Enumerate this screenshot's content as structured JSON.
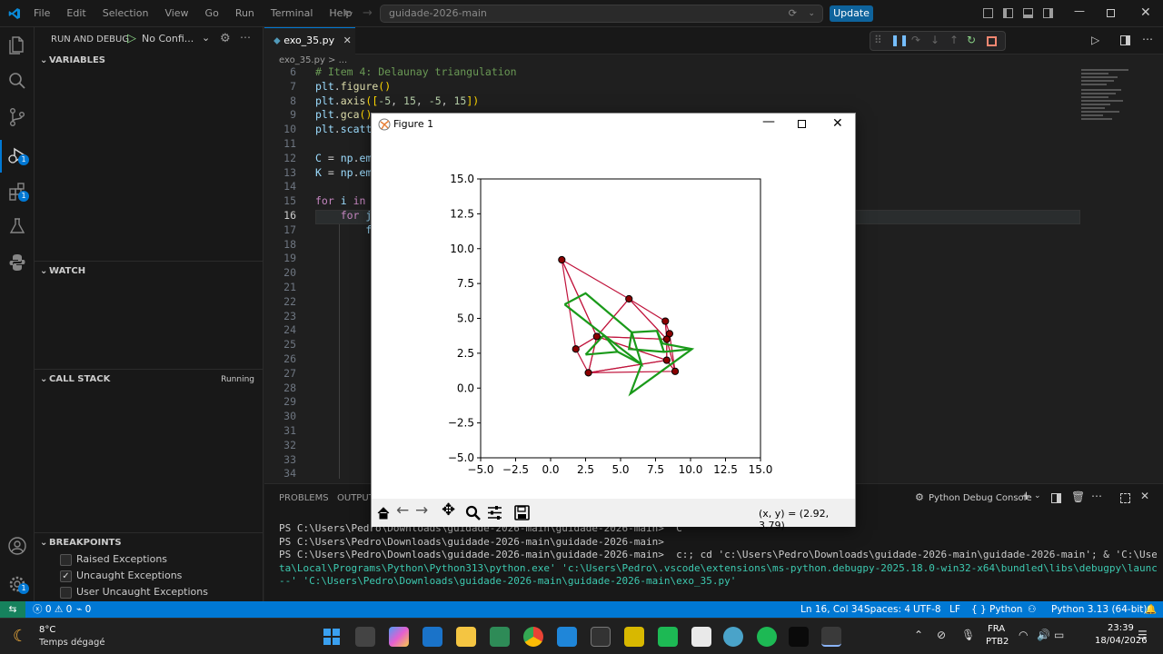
{
  "titlebar": {
    "menus": [
      "File",
      "Edit",
      "Selection",
      "View",
      "Go",
      "Run",
      "Terminal",
      "Help"
    ],
    "search_text": "guidade-2026-main",
    "update_label": "Update"
  },
  "activity": {
    "run_badge": "1",
    "ext_badge": "1"
  },
  "sidebar": {
    "run_title": "RUN AND DEBUG",
    "config": "No Confi...",
    "variables": "VARIABLES",
    "watch": "WATCH",
    "call_stack": "CALL STACK",
    "call_stack_status": "Running",
    "breakpoints": "BREAKPOINTS",
    "bp_items": [
      {
        "label": "Raised Exceptions",
        "checked": false
      },
      {
        "label": "Uncaught Exceptions",
        "checked": true
      },
      {
        "label": "User Uncaught Exceptions",
        "checked": false
      }
    ]
  },
  "editor": {
    "tab_label": "exo_35.py",
    "breadcrumb": "exo_35.py > ...",
    "lines": [
      {
        "n": "6",
        "text": "# Item 4: Delaunay triangulation"
      },
      {
        "n": "7",
        "text": "plt.figure()"
      },
      {
        "n": "8",
        "text": "plt.axis([-5, 15, -5, 15])"
      },
      {
        "n": "9",
        "text": "plt.gca()."
      },
      {
        "n": "10",
        "text": "plt.scatte"
      },
      {
        "n": "11",
        "text": ""
      },
      {
        "n": "12",
        "text": "C = np.emp"
      },
      {
        "n": "13",
        "text": "K = np.emp"
      },
      {
        "n": "14",
        "text": ""
      },
      {
        "n": "15",
        "text": "for i in r"
      },
      {
        "n": "16",
        "text": "    for j"
      },
      {
        "n": "17",
        "text": "        fo"
      },
      {
        "n": "18",
        "text": ""
      },
      {
        "n": "19",
        "text": ""
      },
      {
        "n": "20",
        "text": ""
      },
      {
        "n": "21",
        "text": ""
      },
      {
        "n": "22",
        "text": ""
      },
      {
        "n": "23",
        "text": ""
      },
      {
        "n": "24",
        "text": ""
      },
      {
        "n": "25",
        "text": ""
      },
      {
        "n": "26",
        "text": ""
      },
      {
        "n": "27",
        "text": ""
      },
      {
        "n": "28",
        "text": ""
      },
      {
        "n": "29",
        "text": ""
      },
      {
        "n": "30",
        "text": ""
      },
      {
        "n": "31",
        "text": ""
      },
      {
        "n": "32",
        "text": ""
      },
      {
        "n": "33",
        "text": ""
      },
      {
        "n": "34",
        "text": ""
      }
    ]
  },
  "panel": {
    "tabs": [
      "PROBLEMS",
      "OUTPUT"
    ],
    "console_label": "Python Debug Console",
    "terminal_lines": [
      "PS C:\\Users\\Pedro\\Downloads\\guidade-2026-main\\guidade-2026-main> ^C",
      "PS C:\\Users\\Pedro\\Downloads\\guidade-2026-main\\guidade-2026-main>",
      "PS C:\\Users\\Pedro\\Downloads\\guidade-2026-main\\guidade-2026-main>  c:; cd 'c:\\Users\\Pedro\\Downloads\\guidade-2026-main\\guidade-2026-main'; & 'C:\\Users\\Pedro\\AppDa",
      "ta\\Local\\Programs\\Python\\Python313\\python.exe' 'c:\\Users\\Pedro\\.vscode\\extensions\\ms-python.debugpy-2025.18.0-win32-x64\\bundled\\libs\\debugpy\\launcher' '62157' '",
      "--' 'C:\\Users\\Pedro\\Downloads\\guidade-2026-main\\guidade-2026-main\\exo_35.py'"
    ]
  },
  "statusbar": {
    "errors": "0",
    "warnings": "0",
    "ports": "0",
    "position": "Ln 16, Col 34",
    "spaces": "Spaces: 4",
    "encoding": "UTF-8",
    "eol": "LF",
    "language": "Python",
    "interpreter": "Python 3.13 (64-bit)"
  },
  "taskbar": {
    "weather_temp": "8°C",
    "weather_desc": "Temps dégagé",
    "lang1": "FRA",
    "lang2": "PTB2",
    "time": "23:39",
    "date": "18/04/2026"
  },
  "figure": {
    "title": "Figure 1",
    "coords": "(x, y) = (2.92, 3.79)"
  },
  "colors": {
    "accent": "#0078d4",
    "delaunay": "#c0143c",
    "voronoi": "#1a9a1a"
  },
  "chart_data": {
    "type": "scatter",
    "xlim": [
      -5,
      15
    ],
    "ylim": [
      -5,
      15
    ],
    "xticks": [
      "−5.0",
      "−2.5",
      "0.0",
      "2.5",
      "5.0",
      "7.5",
      "10.0",
      "12.5",
      "15.0"
    ],
    "yticks": [
      "−5.0",
      "−2.5",
      "0.0",
      "2.5",
      "5.0",
      "7.5",
      "10.0",
      "12.5",
      "15.0"
    ],
    "points": [
      [
        0.8,
        9.2
      ],
      [
        5.6,
        6.4
      ],
      [
        8.2,
        4.8
      ],
      [
        8.5,
        3.9
      ],
      [
        8.3,
        3.5
      ],
      [
        3.3,
        3.7
      ],
      [
        1.8,
        2.8
      ],
      [
        2.7,
        1.1
      ],
      [
        8.9,
        1.2
      ],
      [
        8.3,
        2.0
      ]
    ],
    "triangles": [
      [
        0,
        1,
        5
      ],
      [
        0,
        5,
        6
      ],
      [
        5,
        6,
        7
      ],
      [
        1,
        5,
        4
      ],
      [
        1,
        2,
        4
      ],
      [
        2,
        3,
        4
      ],
      [
        5,
        4,
        9
      ],
      [
        5,
        9,
        7
      ],
      [
        7,
        9,
        8
      ],
      [
        4,
        9,
        8
      ],
      [
        3,
        4,
        8
      ]
    ],
    "voronoi_path": [
      [
        1.0,
        6.0
      ],
      [
        2.5,
        6.8
      ],
      [
        5.8,
        4.0
      ],
      [
        6.5,
        1.7
      ],
      [
        3.8,
        3.8
      ],
      [
        1.0,
        6.0
      ]
    ],
    "voronoi_segments": [
      [
        [
          3.8,
          3.8
        ],
        [
          4.8,
          2.6
        ],
        [
          6.5,
          1.7
        ]
      ],
      [
        [
          4.8,
          2.6
        ],
        [
          2.5,
          2.4
        ]
      ],
      [
        [
          2.5,
          2.4
        ],
        [
          3.8,
          3.8
        ]
      ],
      [
        [
          5.8,
          4.0
        ],
        [
          7.6,
          4.1
        ],
        [
          8.0,
          3.2
        ],
        [
          10.1,
          2.8
        ],
        [
          5.7,
          -0.4
        ],
        [
          6.5,
          1.7
        ]
      ],
      [
        [
          5.8,
          4.0
        ],
        [
          5.6,
          2.8
        ],
        [
          8.1,
          2.6
        ],
        [
          10.1,
          2.8
        ]
      ],
      [
        [
          7.6,
          4.1
        ],
        [
          8.1,
          2.6
        ]
      ]
    ]
  }
}
